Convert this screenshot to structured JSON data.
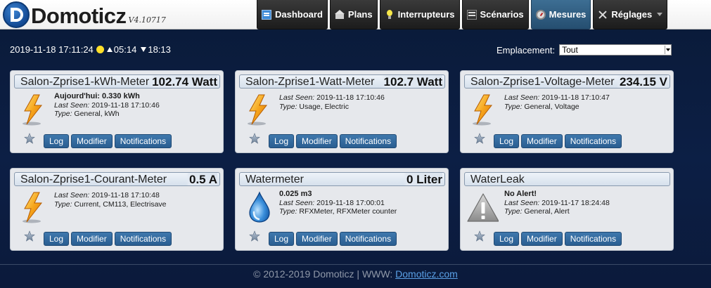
{
  "app": {
    "name": "Domoticz",
    "version": "V4.10717"
  },
  "nav": [
    {
      "label": "Dashboard",
      "icon": "dashboard-icon",
      "active": false
    },
    {
      "label": "Plans",
      "icon": "house-icon",
      "active": false
    },
    {
      "label": "Interrupteurs",
      "icon": "lightbulb-icon",
      "active": false
    },
    {
      "label": "Scénarios",
      "icon": "clapper-icon",
      "active": false
    },
    {
      "label": "Mesures",
      "icon": "meter-icon",
      "active": true
    },
    {
      "label": "Réglages",
      "icon": "tools-icon",
      "active": false
    }
  ],
  "status": {
    "datetime": "2019-11-18 17:11:24",
    "sunrise": "05:14",
    "sunset": "18:13"
  },
  "location": {
    "label": "Emplacement:",
    "selected": "Tout"
  },
  "buttons": {
    "log": "Log",
    "edit": "Modifier",
    "notifications": "Notifications"
  },
  "labels": {
    "last_seen": "Last Seen:",
    "type": "Type:"
  },
  "devices": [
    {
      "name": "Salon-Zprise1-kWh-Meter",
      "value": "102.74 Watt",
      "line1": "Aujourd'hui: 0.330 kWh",
      "last_seen": "2019-11-18 17:10:46",
      "type": "General, kWh",
      "icon": "lightning-icon"
    },
    {
      "name": "Salon-Zprise1-Watt-Meter",
      "value": "102.7 Watt",
      "line1": "",
      "last_seen": "2019-11-18 17:10:46",
      "type": "Usage, Electric",
      "icon": "lightning-icon"
    },
    {
      "name": "Salon-Zprise1-Voltage-Meter",
      "value": "234.15 V",
      "line1": "",
      "last_seen": "2019-11-18 17:10:47",
      "type": "General, Voltage",
      "icon": "lightning-icon"
    },
    {
      "name": "Salon-Zprise1-Courant-Meter",
      "value": "0.5 A",
      "line1": "",
      "last_seen": "2019-11-18 17:10:48",
      "type": "Current, CM113, Electrisave",
      "icon": "lightning-icon"
    },
    {
      "name": "Watermeter",
      "value": "0 Liter",
      "line1": "0.025 m3",
      "last_seen": "2019-11-18 17:00:01",
      "type": "RFXMeter, RFXMeter counter",
      "icon": "water-drop-icon"
    },
    {
      "name": "WaterLeak",
      "value": "",
      "line1": "No Alert!",
      "last_seen": "2019-11-17 18:24:48",
      "type": "General, Alert",
      "icon": "alert-icon"
    }
  ],
  "footer": {
    "copyright": "© 2012-2019 Domoticz | WWW: ",
    "link": "Domoticz.com"
  }
}
